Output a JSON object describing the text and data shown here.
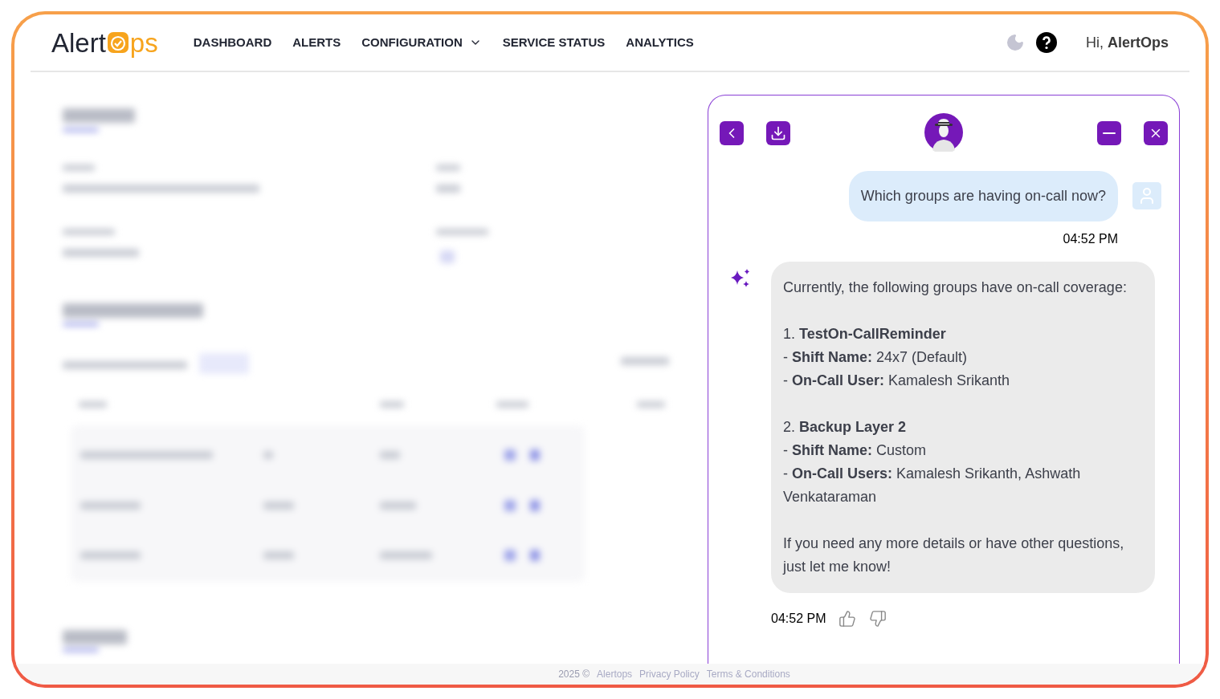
{
  "logo": {
    "before": "Alert",
    "after": "ps"
  },
  "nav": [
    {
      "label": "DASHBOARD",
      "has_menu": false
    },
    {
      "label": "ALERTS",
      "has_menu": false
    },
    {
      "label": "CONFIGURATION",
      "has_menu": true
    },
    {
      "label": "SERVICE STATUS",
      "has_menu": false
    },
    {
      "label": "ANALYTICS",
      "has_menu": false
    }
  ],
  "user": {
    "greeting": "Hi,",
    "name": "AlertOps"
  },
  "chat": {
    "messages": [
      {
        "kind": "user",
        "paragraphs": [
          "Which groups are having on-call now?"
        ],
        "time": "04:52 PM"
      },
      {
        "kind": "assistant",
        "paragraphs": [
          "Currently, the following groups have on-call coverage:",
          "1. **TestOn-CallReminder**\n- **Shift Name:** 24x7 (Default)\n- **On-Call User:** Kamalesh Srikanth",
          "2. **Backup Layer 2**\n- **Shift Name:** Custom\n- **On-Call Users:** Kamalesh Srikanth, Ashwath Venkataraman",
          "If you need any more details or have other questions, just let me know!"
        ],
        "time": "04:52 PM"
      }
    ]
  },
  "footer": {
    "year": "2025 ©",
    "links": [
      "Alertops",
      "Privacy Policy",
      "Terms & Conditions"
    ]
  }
}
